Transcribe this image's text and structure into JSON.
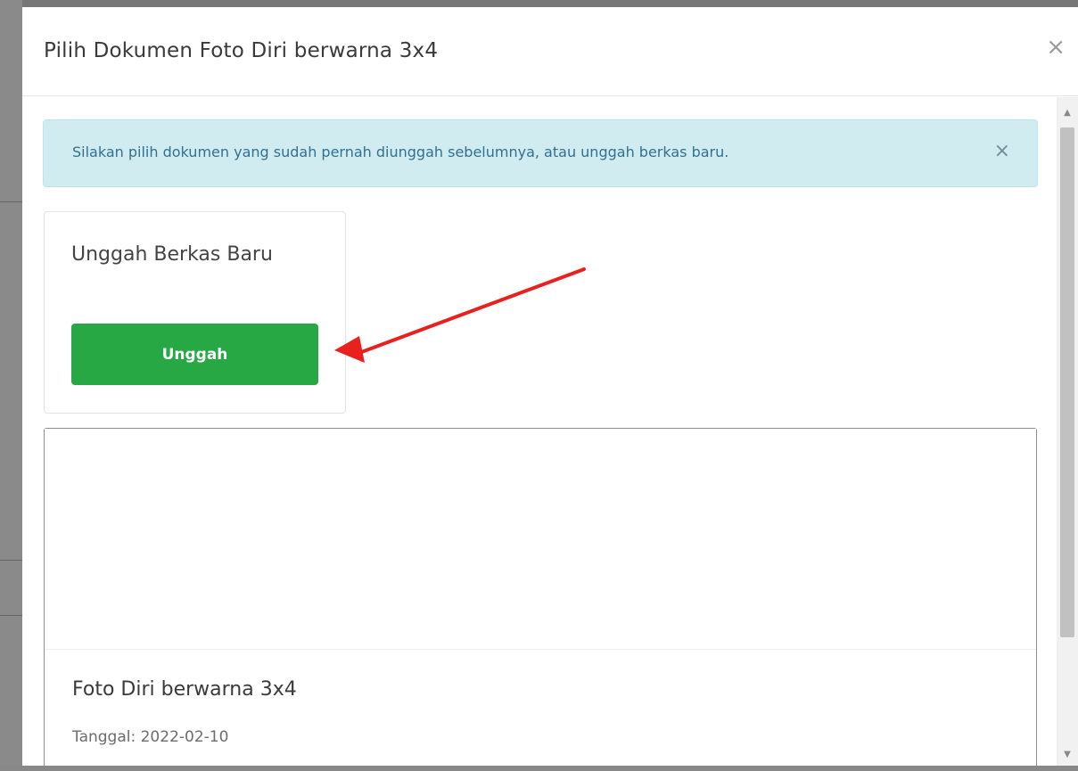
{
  "modal": {
    "title": "Pilih Dokumen Foto Diri berwarna 3x4",
    "close_glyph": "×"
  },
  "alert": {
    "text": "Silakan pilih dokumen yang sudah pernah diunggah sebelumnya, atau unggah berkas baru.",
    "close_glyph": "×",
    "color": "#d1ecf1"
  },
  "upload_card": {
    "title": "Unggah Berkas Baru",
    "button_label": "Unggah",
    "button_color": "#28a745"
  },
  "annotation": {
    "arrow_color": "#e8211f"
  },
  "document": {
    "title": "Foto Diri berwarna 3x4",
    "date": "Tanggal: 2022-02-10"
  },
  "scrollbar": {
    "up_glyph": "▲",
    "down_glyph": "▼"
  }
}
